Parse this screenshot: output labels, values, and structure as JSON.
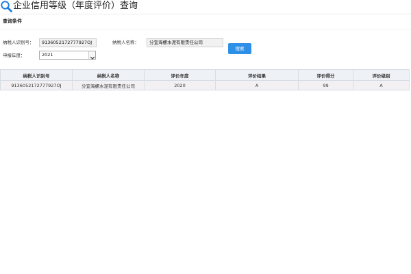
{
  "header": {
    "title": "企业信用等级（年度评价）查询",
    "icon": "search-icon"
  },
  "query": {
    "section_title": "查询条件",
    "taxpayer_id_label": "纳税人识别号：",
    "taxpayer_id_value": "9136052172777927OJ",
    "taxpayer_name_label": "纳税人名称：",
    "taxpayer_name_value": "分宜海螺水泥有限责任公司",
    "year_label": "申报年度：",
    "year_selected": "2021",
    "search_button_label": "搜索"
  },
  "table": {
    "columns": [
      "纳税人识别号",
      "纳税人名称",
      "评价年度",
      "评价结果",
      "评价得分",
      "评价级别"
    ],
    "rows": [
      [
        "9136052172777927OJ",
        "分宜海螺水泥有限责任公司",
        "2020",
        "A",
        "99",
        "A"
      ]
    ]
  },
  "colors": {
    "accent": "#2d8fe6",
    "header_bg": "#eef2f6",
    "row_bg": "#f2f0f2"
  }
}
